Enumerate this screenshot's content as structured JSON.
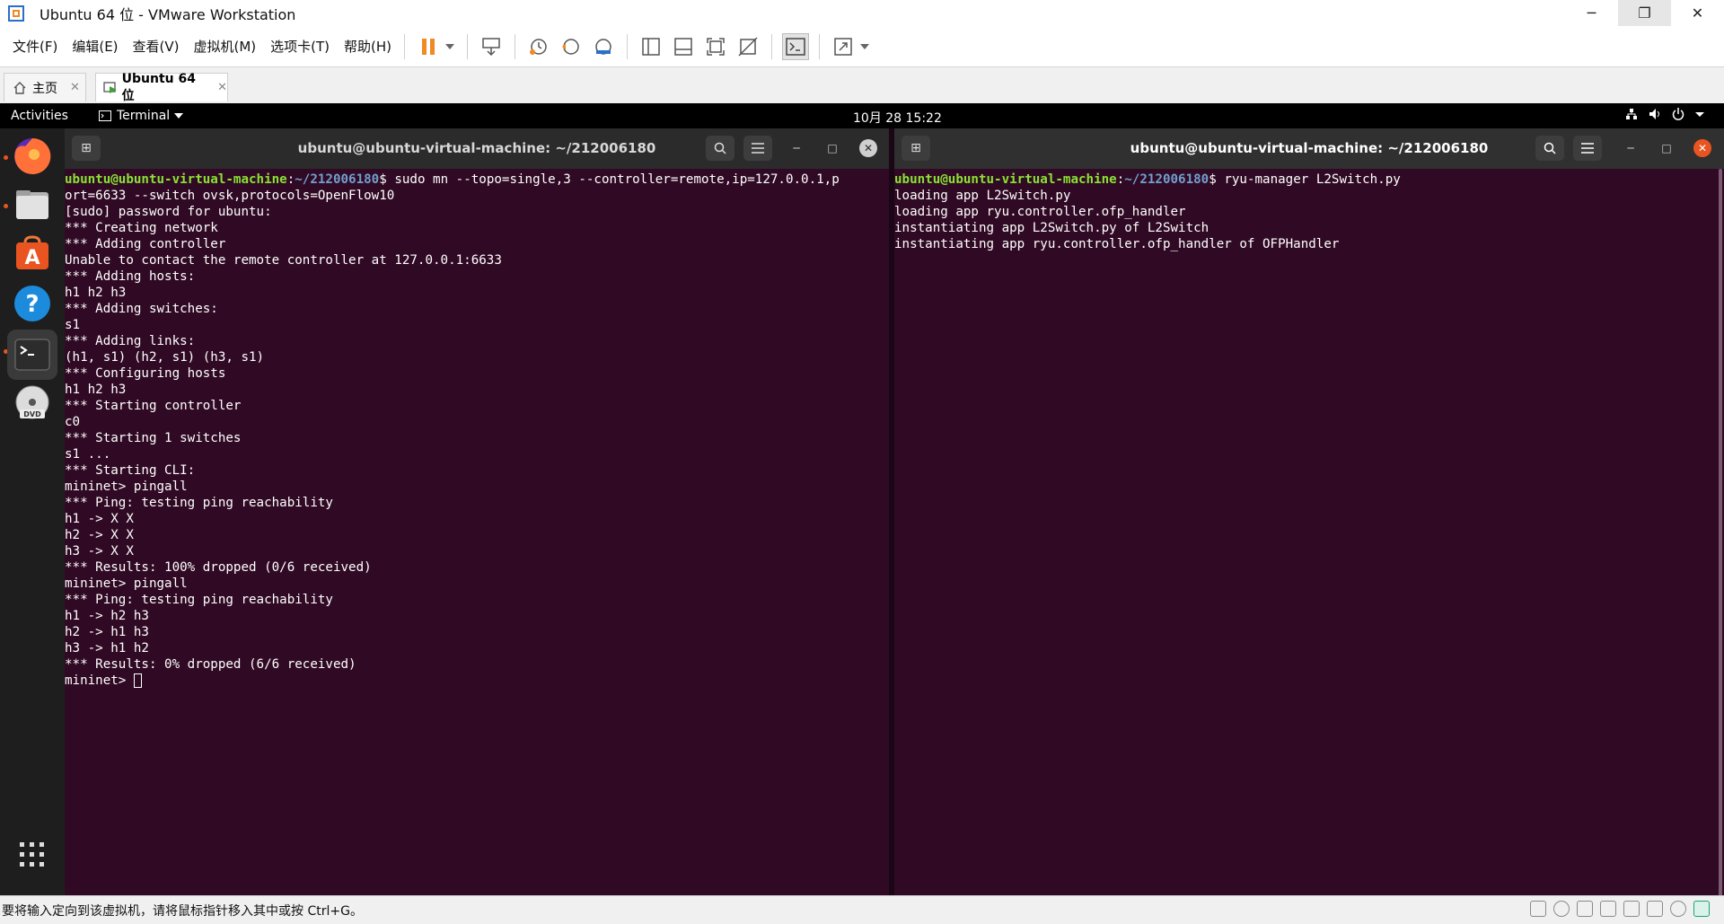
{
  "window": {
    "title": "Ubuntu 64 位 - VMware Workstation"
  },
  "menubar": {
    "items": [
      "文件(F)",
      "编辑(E)",
      "查看(V)",
      "虚拟机(M)",
      "选项卡(T)",
      "帮助(H)"
    ]
  },
  "tabs": [
    {
      "label": "主页",
      "close": "✕"
    },
    {
      "label": "Ubuntu 64 位",
      "close": "✕"
    }
  ],
  "gnome": {
    "activities": "Activities",
    "app_menu": "Terminal",
    "clock": "10月 28  15:22"
  },
  "dock": {
    "items": [
      "firefox-icon",
      "files-icon",
      "software-center-icon",
      "help-icon",
      "terminal-icon",
      "dvd-icon",
      "apps-grid-icon"
    ]
  },
  "terminal_left": {
    "title": "ubuntu@ubuntu-virtual-machine: ~/212006180",
    "prompt_user": "ubuntu@ubuntu-virtual-machine",
    "prompt_path": "~/212006180",
    "command_line1": "$ sudo mn --topo=single,3 --controller=remote,ip=127.0.0.1,p",
    "command_line2": "ort=6633 --switch ovsk,protocols=OpenFlow10",
    "output": [
      "[sudo] password for ubuntu:",
      "*** Creating network",
      "*** Adding controller",
      "Unable to contact the remote controller at 127.0.0.1:6633",
      "*** Adding hosts:",
      "h1 h2 h3",
      "*** Adding switches:",
      "s1",
      "*** Adding links:",
      "(h1, s1) (h2, s1) (h3, s1)",
      "*** Configuring hosts",
      "h1 h2 h3",
      "*** Starting controller",
      "c0",
      "*** Starting 1 switches",
      "s1 ...",
      "*** Starting CLI:",
      "mininet> pingall",
      "*** Ping: testing ping reachability",
      "h1 -> X X",
      "h2 -> X X",
      "h3 -> X X",
      "*** Results: 100% dropped (0/6 received)",
      "mininet> pingall",
      "*** Ping: testing ping reachability",
      "h1 -> h2 h3",
      "h2 -> h1 h3",
      "h3 -> h1 h2",
      "*** Results: 0% dropped (6/6 received)"
    ],
    "final_prompt": "mininet> "
  },
  "terminal_right": {
    "title": "ubuntu@ubuntu-virtual-machine: ~/212006180",
    "prompt_user": "ubuntu@ubuntu-virtual-machine",
    "prompt_path": "~/212006180",
    "command": "$ ryu-manager L2Switch.py",
    "output": [
      "loading app L2Switch.py",
      "loading app ryu.controller.ofp_handler",
      "instantiating app L2Switch.py of L2Switch",
      "instantiating app ryu.controller.ofp_handler of OFPHandler"
    ]
  },
  "statusbar": {
    "message": "要将输入定向到该虚拟机，请将鼠标指针移入其中或按 Ctrl+G。"
  },
  "colors": {
    "terminal_bg": "#300a24",
    "prompt_user": "#8ae234",
    "prompt_path": "#729fcf",
    "accent": "#e95420"
  }
}
